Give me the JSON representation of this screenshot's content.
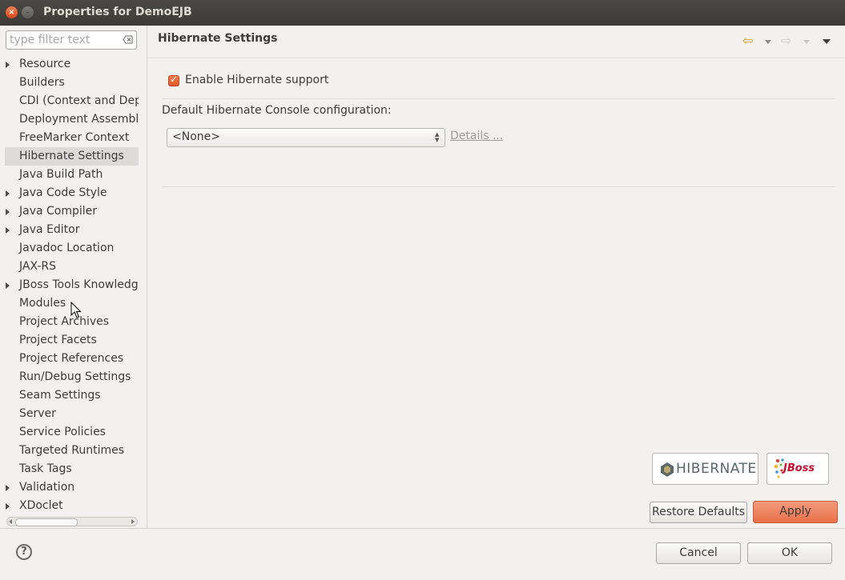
{
  "window": {
    "title": "Properties for DemoEJB",
    "close_glyph": "×",
    "minimize_glyph": "–"
  },
  "filter": {
    "placeholder": "type filter text"
  },
  "tree": {
    "items": [
      {
        "label": "Resource",
        "expandable": true,
        "selected": false
      },
      {
        "label": "Builders",
        "expandable": false,
        "selected": false
      },
      {
        "label": "CDI (Context and Depe",
        "expandable": false,
        "selected": false
      },
      {
        "label": "Deployment Assembly",
        "expandable": false,
        "selected": false
      },
      {
        "label": "FreeMarker Context",
        "expandable": false,
        "selected": false
      },
      {
        "label": "Hibernate Settings",
        "expandable": false,
        "selected": true
      },
      {
        "label": "Java Build Path",
        "expandable": false,
        "selected": false
      },
      {
        "label": "Java Code Style",
        "expandable": true,
        "selected": false
      },
      {
        "label": "Java Compiler",
        "expandable": true,
        "selected": false
      },
      {
        "label": "Java Editor",
        "expandable": true,
        "selected": false
      },
      {
        "label": "Javadoc Location",
        "expandable": false,
        "selected": false
      },
      {
        "label": "JAX-RS",
        "expandable": false,
        "selected": false
      },
      {
        "label": "JBoss Tools Knowledge",
        "expandable": true,
        "selected": false
      },
      {
        "label": "Modules",
        "expandable": false,
        "selected": false
      },
      {
        "label": "Project Archives",
        "expandable": false,
        "selected": false
      },
      {
        "label": "Project Facets",
        "expandable": false,
        "selected": false
      },
      {
        "label": "Project References",
        "expandable": false,
        "selected": false
      },
      {
        "label": "Run/Debug Settings",
        "expandable": false,
        "selected": false
      },
      {
        "label": "Seam Settings",
        "expandable": false,
        "selected": false
      },
      {
        "label": "Server",
        "expandable": false,
        "selected": false
      },
      {
        "label": "Service Policies",
        "expandable": false,
        "selected": false
      },
      {
        "label": "Targeted Runtimes",
        "expandable": false,
        "selected": false
      },
      {
        "label": "Task Tags",
        "expandable": false,
        "selected": false
      },
      {
        "label": "Validation",
        "expandable": true,
        "selected": false
      },
      {
        "label": "XDoclet",
        "expandable": true,
        "selected": false
      }
    ]
  },
  "page": {
    "title": "Hibernate Settings",
    "nav_back_glyph": "⇦",
    "nav_forward_glyph": "⇨",
    "enable_checkbox": {
      "label": "Enable Hibernate support",
      "checked": true,
      "check_glyph": "✓"
    },
    "console_config": {
      "label": "Default Hibernate Console configuration:",
      "value": "<None>",
      "arrows": "▲▼"
    },
    "details_link": "Details ...",
    "logos": {
      "hibernate": "HIBERNATE",
      "jboss": "JBoss"
    }
  },
  "buttons": {
    "restore_pre": "Restore ",
    "restore_underlined": "D",
    "restore_post": "efaults",
    "apply_underlined": "A",
    "apply_post": "pply",
    "cancel": "Cancel",
    "ok": "OK",
    "help_glyph": "?"
  },
  "colors": {
    "accent": "#e9704a",
    "selected_row": "#dcdbd8",
    "titlebar": "#3c3b37",
    "hibernate_brand": "#59666c"
  }
}
